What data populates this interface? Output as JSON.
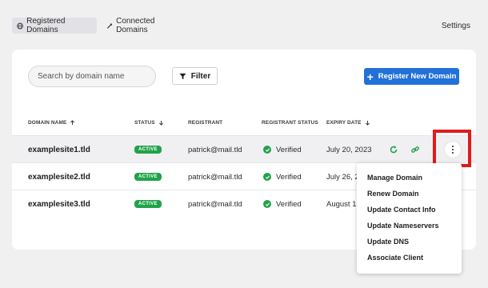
{
  "tabs": [
    {
      "label": "Registered Domains",
      "icon": "globe-icon",
      "active": true
    },
    {
      "label": "Connected Domains",
      "icon": "link-icon",
      "active": false
    }
  ],
  "settings_label": "Settings",
  "toolbar": {
    "search_placeholder": "Search by domain name",
    "filter_label": "Filter",
    "register_label": "Register New Domain"
  },
  "columns": [
    "DOMAIN NAME",
    "STATUS",
    "REGISTRANT",
    "REGISTRANT STATUS",
    "EXPIRY DATE"
  ],
  "rows": [
    {
      "domain": "examplesite1.tld",
      "status": "ACTIVE",
      "registrant": "patrick@mail.tld",
      "registrant_status": "Verified",
      "expiry": "July 20, 2023"
    },
    {
      "domain": "examplesite2.tld",
      "status": "ACTIVE",
      "registrant": "patrick@mail.tld",
      "registrant_status": "Verified",
      "expiry": "July 26, 2"
    },
    {
      "domain": "examplesite3.tld",
      "status": "ACTIVE",
      "registrant": "patrick@mail.tld",
      "registrant_status": "Verified",
      "expiry": "August 1"
    }
  ],
  "menu": [
    "Manage Domain",
    "Renew Domain",
    "Update Contact Info",
    "Update Nameservers",
    "Update DNS",
    "Associate Client"
  ],
  "colors": {
    "accent": "#2271d8",
    "active_badge": "#21a24a",
    "highlight": "#e01b1b"
  }
}
